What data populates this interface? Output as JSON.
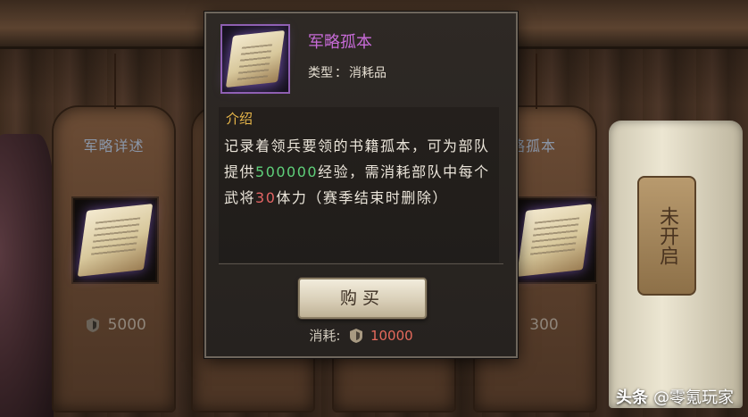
{
  "background_cards": [
    {
      "title": "军略详述",
      "price": "5000"
    },
    {
      "title": "",
      "price": ""
    },
    {
      "title": "",
      "price": ""
    },
    {
      "title": "略孤本",
      "price": "300"
    }
  ],
  "locked_slot": {
    "label": "未开启"
  },
  "popup": {
    "item_name": "军略孤本",
    "type_label": "类型",
    "type_value": "消耗品",
    "intro_title": "介绍",
    "desc_part1": "记录着领兵要领的书籍孤本，可为部队提供",
    "desc_exp": "500000",
    "desc_part2": "经验，需消耗部队中每个武将",
    "desc_stamina": "30",
    "desc_part3": "体力（赛季结束时删除）",
    "buy_label": "购买",
    "cost_label": "消耗:",
    "cost_value": "10000"
  },
  "watermark": {
    "brand": "头条",
    "account": "@零氪玩家"
  },
  "colors": {
    "item_name": "#c86bd8",
    "intro_title": "#e9b84a",
    "exp": "#5fd07a",
    "stamina": "#e26464"
  },
  "icons": {
    "item": "book-scroll-icon",
    "currency": "shield-coin-icon"
  }
}
